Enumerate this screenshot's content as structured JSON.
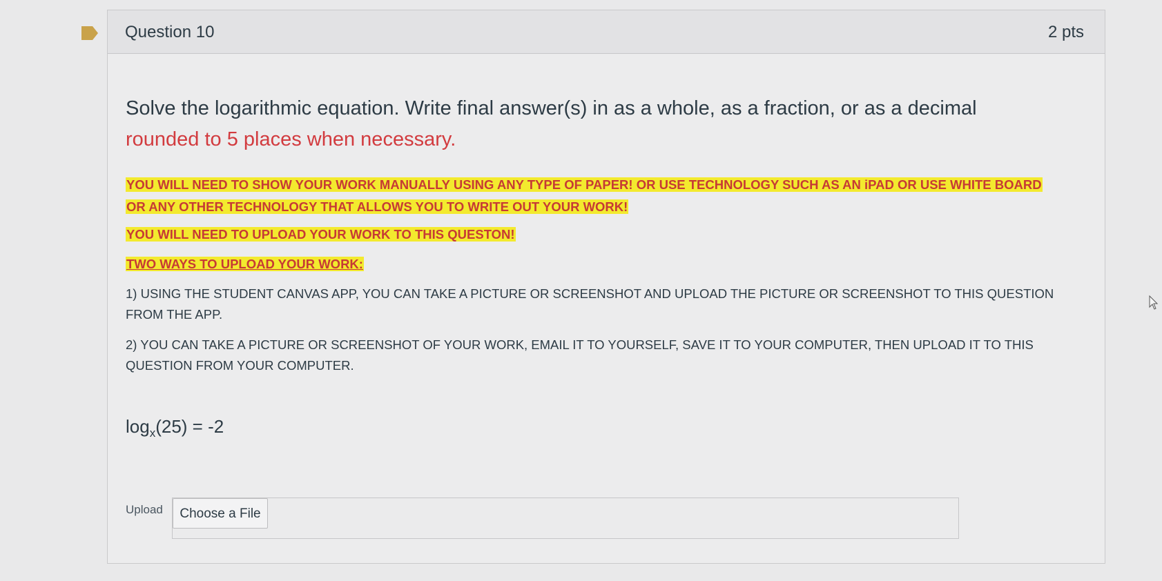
{
  "question": {
    "title": "Question 10",
    "points": "2 pts",
    "prompt_main": "Solve the logarithmic equation. Write final answer(s) in as a whole, as a fraction, or as a decimal",
    "prompt_red": "rounded to 5 places when necessary.",
    "highlight_1_line1": "YOU WILL NEED TO SHOW YOUR WORK MANUALLY USING ANY TYPE OF PAPER! OR USE TECHNOLOGY SUCH AS AN iPAD OR USE WHITE BOARD",
    "highlight_1_line2": "OR ANY OTHER TECHNOLOGY THAT ALLOWS YOU TO WRITE OUT YOUR WORK!",
    "highlight_2": "YOU WILL NEED TO UPLOAD YOUR WORK TO THIS QUESTON!",
    "highlight_3": "TWO WAYS TO UPLOAD YOUR WORK:",
    "step_1": "1) USING THE STUDENT CANVAS APP, YOU CAN TAKE A PICTURE OR SCREENSHOT AND UPLOAD THE PICTURE OR SCREENSHOT TO THIS QUESTION FROM THE APP.",
    "step_2": "2) YOU CAN TAKE A PICTURE OR SCREENSHOT OF YOUR WORK, EMAIL IT TO YOURSELF, SAVE IT TO YOUR COMPUTER, THEN UPLOAD IT TO THIS QUESTION FROM YOUR COMPUTER.",
    "equation_log": "log",
    "equation_base": "x",
    "equation_rest": "(25) = -2"
  },
  "upload": {
    "label": "Upload",
    "button_label": "Choose a File"
  },
  "colors": {
    "highlight": "#f3ea2e",
    "highlight_text": "#c63a35",
    "prompt_red": "#d23b3f",
    "flag": "#c9a24a"
  }
}
